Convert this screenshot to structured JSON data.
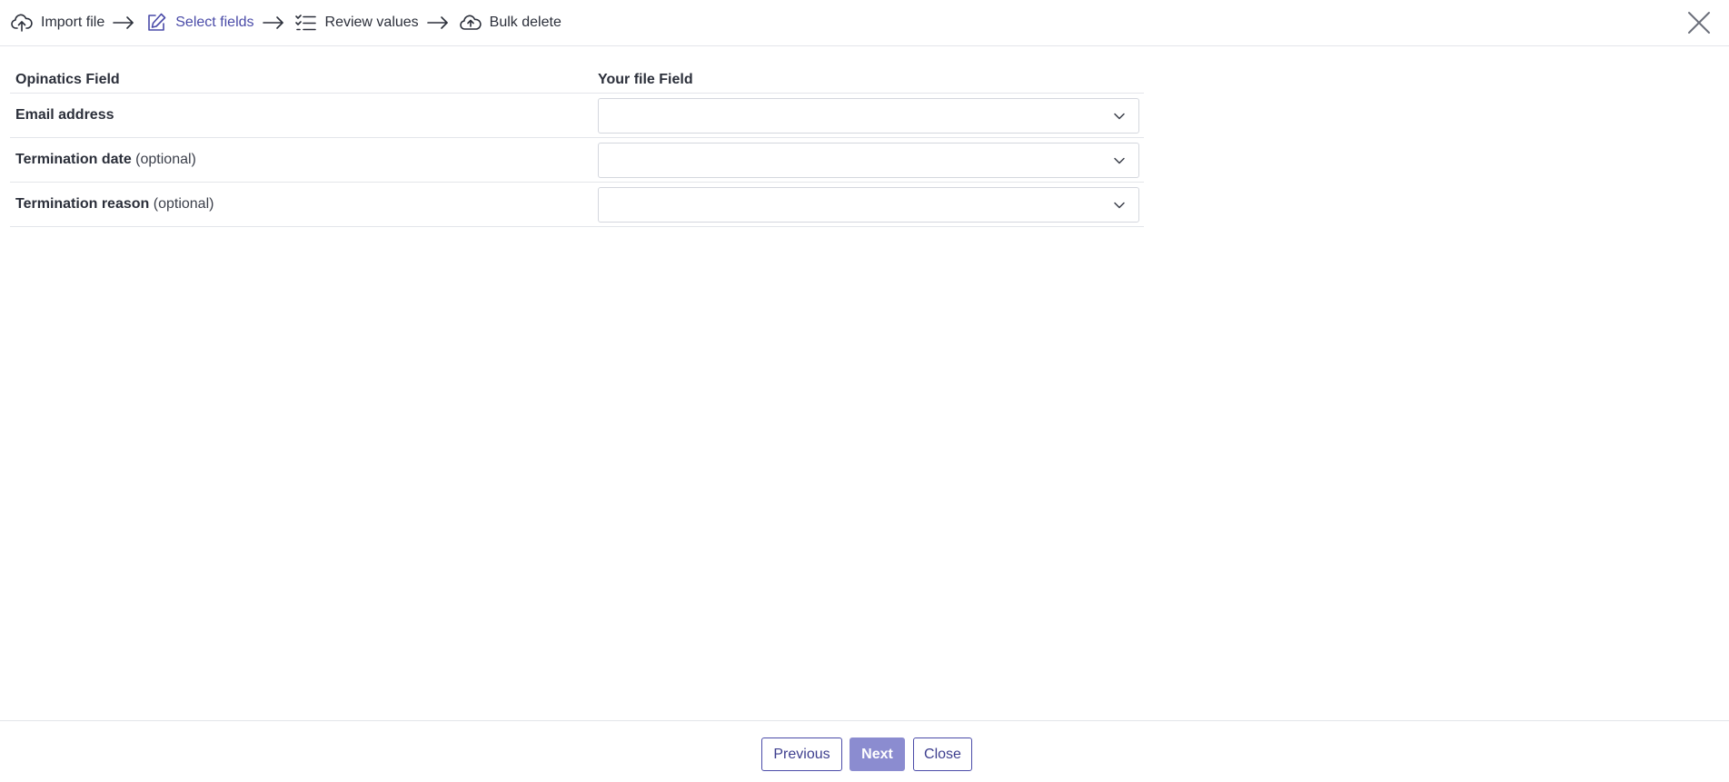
{
  "steps": [
    {
      "label": "Import file",
      "icon": "cloud-upload-icon",
      "active": false
    },
    {
      "label": "Select fields",
      "icon": "edit-icon",
      "active": true
    },
    {
      "label": "Review values",
      "icon": "checklist-icon",
      "active": false
    },
    {
      "label": "Bulk delete",
      "icon": "cloud-upload-icon",
      "active": false
    }
  ],
  "colors": {
    "accent": "#4a4ba8",
    "primary_button": "#8b8cd0",
    "border": "#e3e5ea"
  },
  "table": {
    "headers": {
      "left": "Opinatics Field",
      "right": "Your file Field"
    },
    "rows": [
      {
        "field": "Email address",
        "suffix": "",
        "selected_value": ""
      },
      {
        "field": "Termination date",
        "suffix": "(optional)",
        "selected_value": ""
      },
      {
        "field": "Termination reason",
        "suffix": "(optional)",
        "selected_value": ""
      }
    ]
  },
  "footer": {
    "previous_label": "Previous",
    "next_label": "Next",
    "close_label": "Close"
  }
}
